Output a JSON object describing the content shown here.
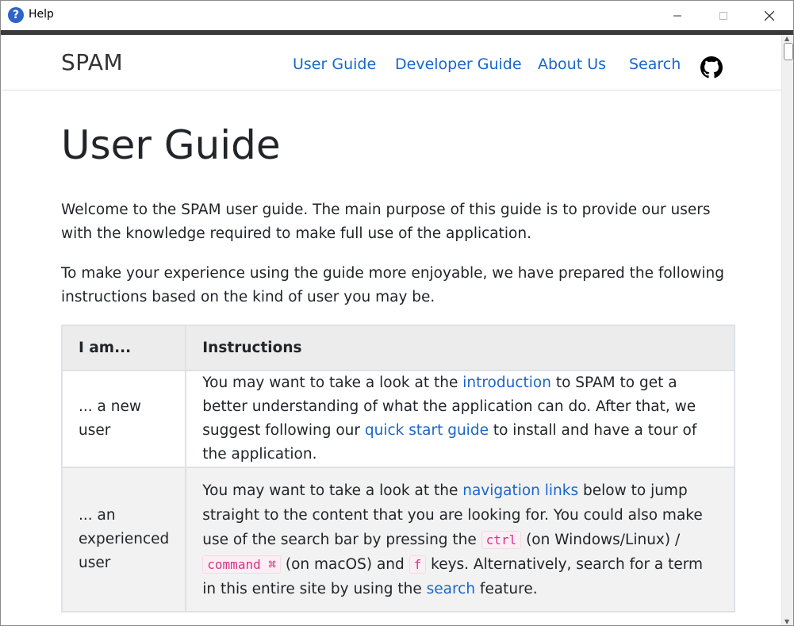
{
  "window": {
    "title": "Help"
  },
  "navbar": {
    "brand": "SPAM",
    "links": [
      "User Guide",
      "Developer Guide",
      "About Us",
      "Search"
    ]
  },
  "page": {
    "title": "User Guide",
    "intro": "Welcome to the SPAM user guide. The main purpose of this guide is to provide our users with the knowledge required to make full use of the application.",
    "prep": "To make your experience using the guide more enjoyable, we have prepared the following instructions based on the kind of user you may be."
  },
  "table": {
    "headers": [
      "I am...",
      "Instructions"
    ],
    "rows": [
      {
        "who": "... a new user",
        "t1": "You may want to take a look at the ",
        "l1": "introduction",
        "t2": " to SPAM to get a better understanding of what the application can do. After that, we suggest following our ",
        "l2": "quick start guide",
        "t3": " to install and have a tour of the application."
      },
      {
        "who": "... an experienced user",
        "t1": "You may want to take a look at the ",
        "l1": "navigation links",
        "t2": " below to jump straight to the content that you are looking for. You could also make use of the search bar by pressing the ",
        "k1": "ctrl",
        "t3": " (on Windows/Linux) / ",
        "k2": "command ⌘",
        "t4": " (on macOS) and ",
        "k3": "f",
        "t5": " keys. Alternatively, search for a term in this entire site by using the ",
        "l2": "search",
        "t6": " feature."
      }
    ]
  },
  "colors": {
    "link": "#1a66c9",
    "code": "#d63384",
    "header_bg": "#ececec"
  }
}
